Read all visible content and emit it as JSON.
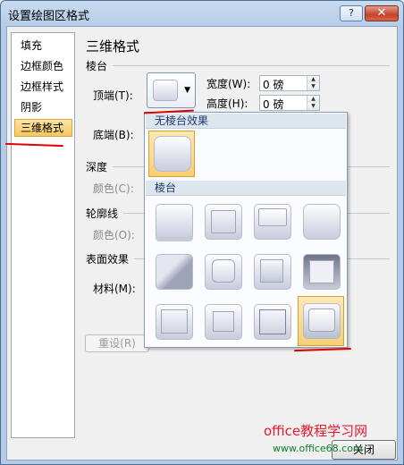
{
  "window": {
    "title": "设置绘图区格式",
    "help_label": "?",
    "close_label": "✕"
  },
  "nav": {
    "items": [
      {
        "label": "填充",
        "selected": false
      },
      {
        "label": "边框颜色",
        "selected": false
      },
      {
        "label": "边框样式",
        "selected": false
      },
      {
        "label": "阴影",
        "selected": false
      },
      {
        "label": "三维格式",
        "selected": true
      }
    ]
  },
  "panel": {
    "heading": "三维格式",
    "bevel_group": "棱台",
    "top_label": "顶端(T):",
    "bottom_label": "底端(B):",
    "width_label": "宽度(W):",
    "height_label": "高度(H):",
    "top_width_value": "0 磅",
    "top_height_value": "0 磅",
    "depth_group": "深度",
    "depth_color_label": "颜色(C):",
    "contour_group": "轮廓线",
    "contour_color_label": "颜色(O):",
    "surface_group": "表面效果",
    "material_label": "材料(M):",
    "reset_label": "重设(R)",
    "close_button": "关闭"
  },
  "gallery": {
    "no_bevel_header": "无棱台效果",
    "bevel_header": "棱台",
    "selected_preset": "12",
    "icons": {
      "no_bevel": "bevel-none-icon",
      "presets": [
        "circle",
        "relaxed-inset",
        "cross",
        "cool-slant",
        "angle",
        "soft-round",
        "convex",
        "slope",
        "divot",
        "riblet",
        "hard-edge",
        "art-deco"
      ]
    }
  },
  "watermark": {
    "text": "office教程学习网",
    "url": "www.office68.com"
  },
  "colors": {
    "selection": "#f8cf73",
    "annotation": "#e00000",
    "watermark": "#e8192c"
  }
}
